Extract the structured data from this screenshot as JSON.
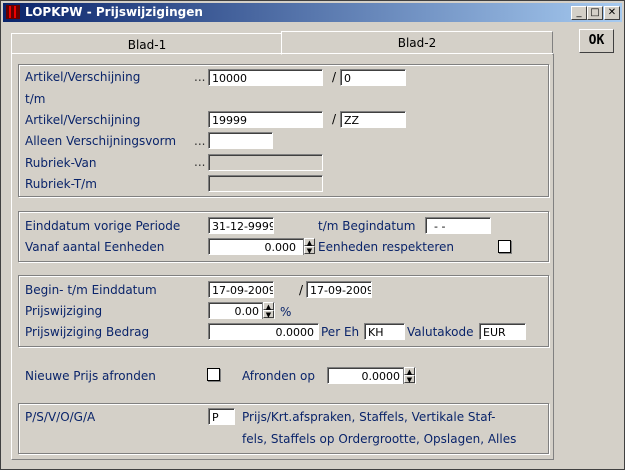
{
  "window": {
    "title": "LOPKPW - Prijswijzigingen",
    "controls": {
      "minimize": "_",
      "maximize": "□",
      "close": "✕"
    }
  },
  "tabs": [
    {
      "label": "Blad-1",
      "active": false
    },
    {
      "label": "Blad-2",
      "active": true
    }
  ],
  "ok_button": "OK",
  "section1": {
    "artikel_van_label": "Artikel/Verschijning",
    "artikel_van_value": "10000",
    "versch_van_value": "0",
    "tm_label": "t/m",
    "artikel_tm_label": "Artikel/Verschijning",
    "artikel_tm_value": "19999",
    "versch_tm_value": "ZZ",
    "alleen_label": "Alleen Verschijningsvorm",
    "alleen_value": "",
    "rubriek_van_label": "Rubriek-Van",
    "rubriek_tm_label": "Rubriek-T/m"
  },
  "section2": {
    "einddatum_label": "Einddatum vorige Periode",
    "einddatum_value": "31-12-9999",
    "begindatum_label": "t/m Begindatum",
    "begindatum_value": "- -",
    "vanaf_label": "Vanaf aantal Eenheden",
    "vanaf_value": "0.000",
    "eenheden_label": "Eenheden respekteren",
    "eenheden_checked": false
  },
  "section3": {
    "begin_label": "Begin- t/m Einddatum",
    "begin_value": "17-09-2009",
    "eind_value": "17-09-2009",
    "pw_label": "Prijswijziging",
    "pw_value": "0.00",
    "pw_unit": "%",
    "pwb_label": "Prijswijziging Bedrag",
    "pwb_value": "0.0000",
    "pereh_label": "Per Eh",
    "pereh_value": "KH",
    "valuta_label": "Valutakode",
    "valuta_value": "EUR"
  },
  "section4": {
    "afronden_label": "Nieuwe Prijs afronden",
    "afronden_checked": false,
    "afronden_op_label": "Afronden op",
    "afronden_op_value": "0.0000"
  },
  "section5": {
    "psvoga_label": "P/S/V/O/G/A",
    "psvoga_value": "P",
    "desc_line1": "Prijs/Krt.afspraken, Staffels, Vertikale Staf-",
    "desc_line2": "fels, Staffels op Ordergrootte, Opslagen, Alles"
  },
  "colors": {
    "title_start": "#0a246a",
    "title_end": "#a6caf0",
    "label": "#0a246a",
    "background": "#d4d0c8"
  }
}
